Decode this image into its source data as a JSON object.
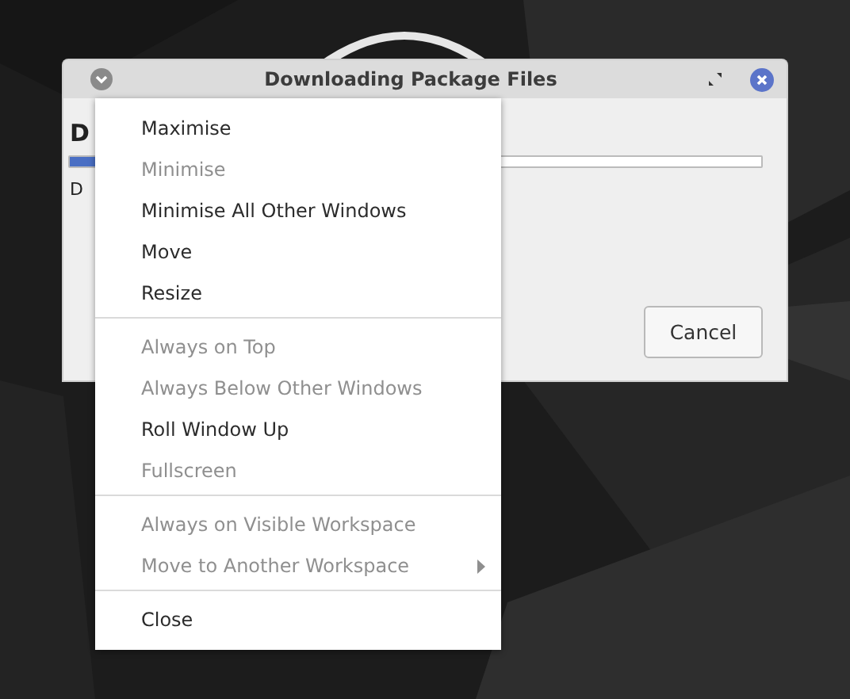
{
  "window": {
    "title": "Downloading Package Files",
    "heading": "D",
    "progress": {
      "level": 0.06
    },
    "status": "D",
    "buttons": [
      {
        "label": "Cancel"
      }
    ]
  },
  "context_menu": {
    "sections": [
      {
        "items": [
          {
            "label": "Maximise",
            "disabled": false,
            "submenu": false
          },
          {
            "label": "Minimise",
            "disabled": true,
            "submenu": false
          },
          {
            "label": "Minimise All Other Windows",
            "disabled": false,
            "submenu": false
          },
          {
            "label": "Move",
            "disabled": false,
            "submenu": false
          },
          {
            "label": "Resize",
            "disabled": false,
            "submenu": false
          }
        ]
      },
      {
        "items": [
          {
            "label": "Always on Top",
            "disabled": true,
            "submenu": false
          },
          {
            "label": "Always Below Other Windows",
            "disabled": true,
            "submenu": false
          },
          {
            "label": "Roll Window Up",
            "disabled": false,
            "submenu": false
          },
          {
            "label": "Fullscreen",
            "disabled": true,
            "submenu": false
          }
        ]
      },
      {
        "items": [
          {
            "label": "Always on Visible Workspace",
            "disabled": true,
            "submenu": false
          },
          {
            "label": "Move to Another Workspace",
            "disabled": true,
            "submenu": true
          }
        ]
      },
      {
        "items": [
          {
            "label": "Close",
            "disabled": false,
            "submenu": false
          }
        ]
      }
    ]
  }
}
